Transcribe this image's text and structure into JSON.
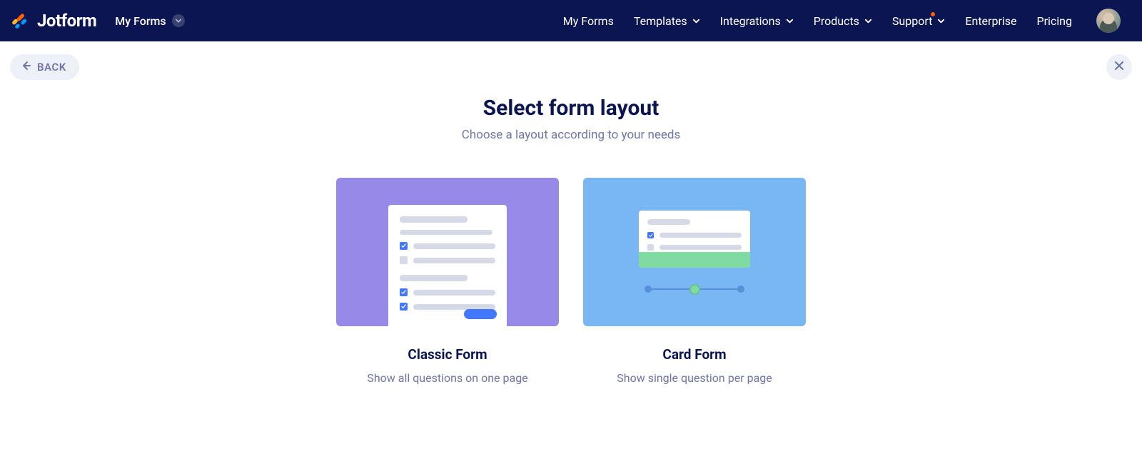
{
  "brand": {
    "name": "Jotform"
  },
  "nav": {
    "context_label": "My Forms",
    "items": [
      {
        "label": "My Forms",
        "dropdown": false,
        "badge": false
      },
      {
        "label": "Templates",
        "dropdown": true,
        "badge": false
      },
      {
        "label": "Integrations",
        "dropdown": true,
        "badge": false
      },
      {
        "label": "Products",
        "dropdown": true,
        "badge": false
      },
      {
        "label": "Support",
        "dropdown": true,
        "badge": true
      },
      {
        "label": "Enterprise",
        "dropdown": false,
        "badge": false
      },
      {
        "label": "Pricing",
        "dropdown": false,
        "badge": false
      }
    ]
  },
  "back_label": "BACK",
  "page": {
    "title": "Select form layout",
    "subtitle": "Choose a layout according to your needs"
  },
  "options": {
    "classic": {
      "title": "Classic Form",
      "subtitle": "Show all questions on one page"
    },
    "card": {
      "title": "Card Form",
      "subtitle": "Show single question per page"
    }
  }
}
